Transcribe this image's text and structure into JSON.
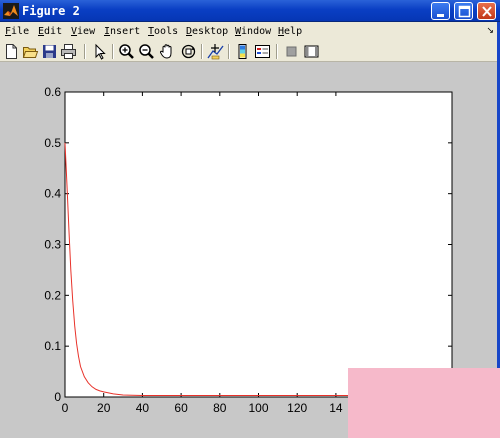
{
  "window": {
    "title": "Figure 2"
  },
  "menu": {
    "items": [
      {
        "key": "F",
        "rest": "ile"
      },
      {
        "key": "E",
        "rest": "dit"
      },
      {
        "key": "V",
        "rest": "iew"
      },
      {
        "key": "I",
        "rest": "nsert"
      },
      {
        "key": "T",
        "rest": "ools"
      },
      {
        "key": "D",
        "rest": "esktop"
      },
      {
        "key": "W",
        "rest": "indow"
      },
      {
        "key": "H",
        "rest": "elp"
      }
    ],
    "overflow_arrow": "↘"
  },
  "toolbar": {
    "icons": [
      "new-file-icon",
      "open-folder-icon",
      "save-icon",
      "print-icon",
      "pointer-icon",
      "zoom-in-icon",
      "zoom-out-icon",
      "pan-hand-icon",
      "rotate-3d-icon",
      "data-cursor-icon",
      "colorbar-icon",
      "legend-icon",
      "hide-plot-tools-icon",
      "show-plot-tools-icon"
    ]
  },
  "colors": {
    "line": "#e8322a",
    "axes_bg": "#ffffff",
    "figure_bg": "#c8c8c8",
    "titlebar": "#0a3fc4"
  },
  "chart_data": {
    "type": "line",
    "title": "",
    "xlabel": "",
    "ylabel": "",
    "xlim": [
      0,
      200
    ],
    "ylim": [
      0,
      0.6
    ],
    "xticks": [
      0,
      20,
      40,
      60,
      80,
      100,
      120,
      140
    ],
    "xtick_labels": [
      "0",
      "20",
      "40",
      "60",
      "80",
      "100",
      "120",
      "14"
    ],
    "yticks": [
      0,
      0.1,
      0.2,
      0.3,
      0.4,
      0.5,
      0.6
    ],
    "ytick_labels": [
      "0",
      "0.1",
      "0.2",
      "0.3",
      "0.4",
      "0.5",
      "0.6"
    ],
    "grid": false,
    "series": [
      {
        "color": "#e8322a",
        "x": [
          0,
          1,
          2,
          3,
          4,
          5,
          6,
          7,
          8,
          10,
          12,
          14,
          16,
          18,
          20,
          25,
          30,
          40,
          50,
          60,
          80,
          100,
          120,
          140,
          160,
          180
        ],
        "y": [
          0.5,
          0.42,
          0.33,
          0.25,
          0.19,
          0.14,
          0.105,
          0.08,
          0.06,
          0.04,
          0.028,
          0.02,
          0.015,
          0.012,
          0.01,
          0.006,
          0.004,
          0.003,
          0.003,
          0.003,
          0.003,
          0.003,
          0.003,
          0.003,
          0.003,
          0.003
        ]
      }
    ]
  }
}
